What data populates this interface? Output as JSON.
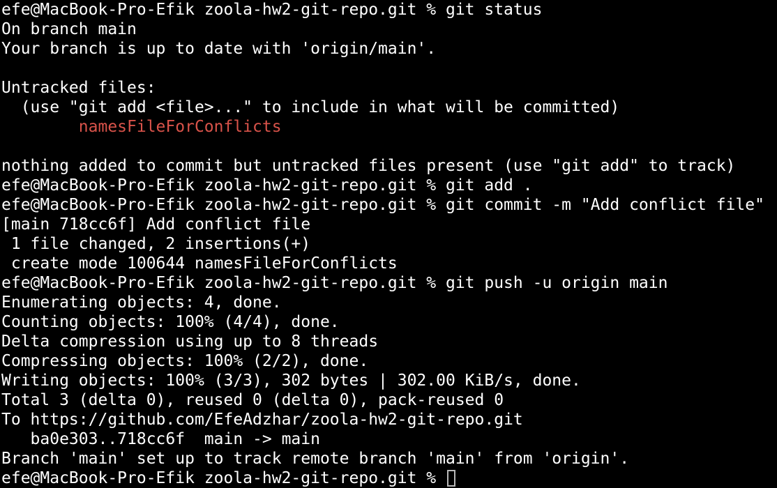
{
  "terminal": {
    "colors": {
      "background": "#000000",
      "text": "#ffffff",
      "untracked": "#d9534a",
      "cursor": "#b8b8b8"
    },
    "lines": [
      "efe@MacBook-Pro-Efik zoola-hw2-git-repo.git % git status",
      "On branch main",
      "Your branch is up to date with 'origin/main'.",
      "",
      "Untracked files:",
      "  (use \"git add <file>...\" to include in what will be committed)",
      "nothing added to commit but untracked files present (use \"git add\" to track)",
      "efe@MacBook-Pro-Efik zoola-hw2-git-repo.git % git add .",
      "efe@MacBook-Pro-Efik zoola-hw2-git-repo.git % git commit -m \"Add conflict file\"",
      "[main 718cc6f] Add conflict file",
      " 1 file changed, 2 insertions(+)",
      " create mode 100644 namesFileForConflicts",
      "efe@MacBook-Pro-Efik zoola-hw2-git-repo.git % git push -u origin main",
      "Enumerating objects: 4, done.",
      "Counting objects: 100% (4/4), done.",
      "Delta compression using up to 8 threads",
      "Compressing objects: 100% (2/2), done.",
      "Writing objects: 100% (3/3), 302 bytes | 302.00 KiB/s, done.",
      "Total 3 (delta 0), reused 0 (delta 0), pack-reused 0",
      "To https://github.com/EfeAdzhar/zoola-hw2-git-repo.git",
      "   ba0e303..718cc6f  main -> main",
      "Branch 'main' set up to track remote branch 'main' from 'origin'.",
      "efe@MacBook-Pro-Efik zoola-hw2-git-repo.git % "
    ],
    "untracked_file": "        namesFileForConflicts"
  }
}
